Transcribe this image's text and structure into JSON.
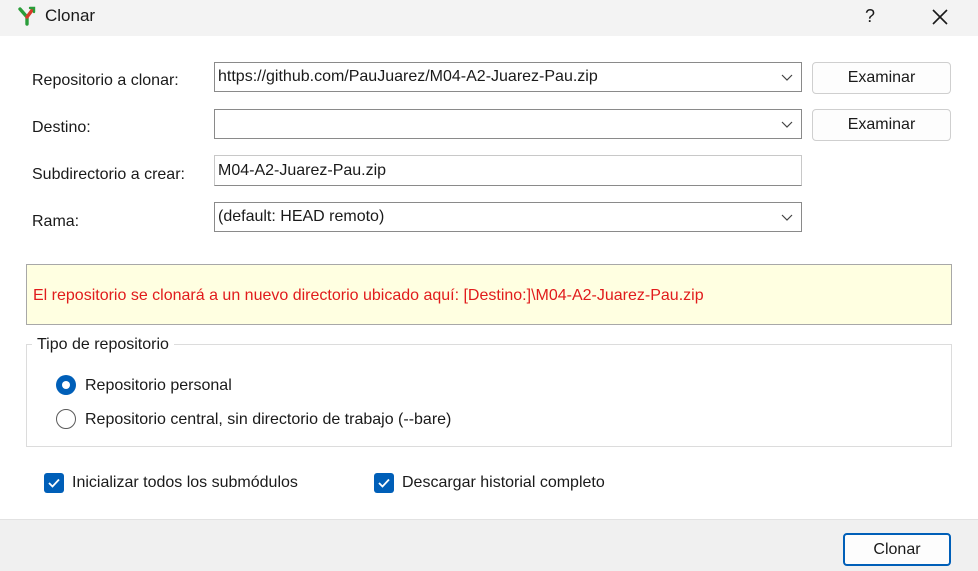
{
  "window": {
    "title": "Clonar",
    "help_label": "?",
    "icons": {
      "app": "git-branch-icon",
      "close": "close-icon"
    }
  },
  "form": {
    "repo_label": "Repositorio a clonar:",
    "repo_value": "https://github.com/PauJuarez/M04-A2-Juarez-Pau.zip",
    "dest_label": "Destino:",
    "dest_value": "",
    "subdir_label": "Subdirectorio a crear:",
    "subdir_value": "M04-A2-Juarez-Pau.zip",
    "branch_label": "Rama:",
    "branch_value": "(default: HEAD remoto)",
    "browse_label": "Examinar"
  },
  "info": {
    "message": "El repositorio se clonará a un nuevo directorio ubicado aquí: [Destino:]\\M04-A2-Juarez-Pau.zip",
    "text_color": "#e11c1c",
    "background": "#ffffe1"
  },
  "repo_type": {
    "legend": "Tipo de repositorio",
    "options": [
      {
        "label": "Repositorio personal",
        "selected": true
      },
      {
        "label": "Repositorio central, sin directorio de trabajo (--bare)",
        "selected": false
      }
    ]
  },
  "options": {
    "init_submodules": {
      "label": "Inicializar todos los submódulos",
      "checked": true
    },
    "full_history": {
      "label": "Descargar historial completo",
      "checked": true
    }
  },
  "footer": {
    "clone_label": "Clonar"
  },
  "colors": {
    "accent": "#005fb8"
  }
}
